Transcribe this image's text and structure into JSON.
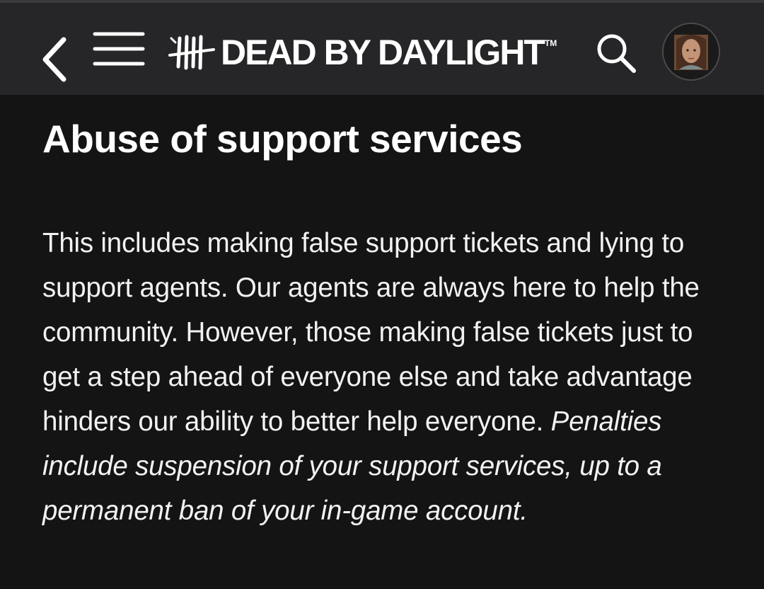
{
  "header": {
    "logo_text": "DEAD BY DAYLIGHT",
    "logo_tm": "TM"
  },
  "article": {
    "title": "Abuse of support services",
    "body_plain": "This includes making false support tickets and lying to support agents. Our agents are always here to help the community. However, those making false tickets just to get a step ahead of everyone else and take advantage hinders our ability to better help everyone. ",
    "body_italic": "Penalties include suspension of your support services, up to a permanent ban of your in-game account."
  },
  "icons": {
    "back": "chevron-left-icon",
    "menu": "hamburger-menu-icon",
    "logo": "tally-marks-logo-icon",
    "search": "search-icon",
    "avatar": "user-avatar"
  },
  "colors": {
    "page_background": "#141414",
    "header_background": "#262528",
    "text": "#ffffff"
  }
}
